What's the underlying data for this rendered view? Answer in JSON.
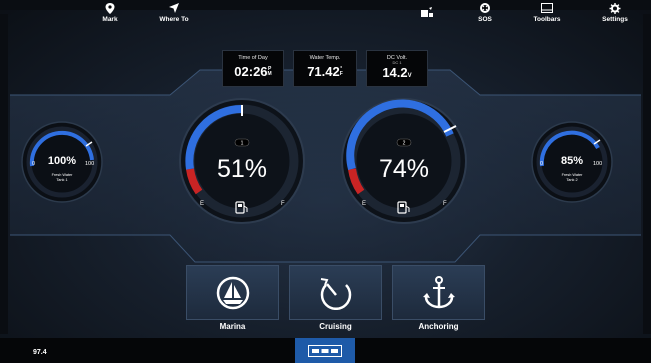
{
  "info": {
    "time": {
      "label": "Time of Day",
      "value": "02:26",
      "unit_top": "P",
      "unit_bottom": "M"
    },
    "water": {
      "label": "Water Temp.",
      "value": "71.42",
      "unit_top": "°",
      "unit_bottom": "F"
    },
    "dc": {
      "label": "DC Volt.",
      "sub": "DC 1",
      "value": "14.2",
      "unit": "V"
    }
  },
  "gauges": {
    "fresh1": {
      "value": "100%",
      "min": "0",
      "max": "100",
      "name_line1": "Fresh Water",
      "name_line2": "Tank 1",
      "level": 1.0
    },
    "fuel1": {
      "value": "51%",
      "index": "1",
      "empty": "E",
      "full": "F",
      "level": 0.51
    },
    "fuel2": {
      "value": "74%",
      "index": "2",
      "empty": "E",
      "full": "F",
      "level": 0.74
    },
    "fresh2": {
      "value": "85%",
      "min": "0",
      "max": "100",
      "name_line1": "Fresh Water",
      "name_line2": "Tank 2",
      "level": 0.85
    }
  },
  "modes": [
    {
      "label": "Marina",
      "icon": "sailboat-icon"
    },
    {
      "label": "Cruising",
      "icon": "gauge-icon"
    },
    {
      "label": "Anchoring",
      "icon": "anchor-icon"
    }
  ],
  "bottom_bar": {
    "speed": "97.4",
    "mark": "Mark",
    "where_to": "Where To",
    "sos": "SOS",
    "toolbars": "Toolbars",
    "settings": "Settings"
  },
  "colors": {
    "accent": "#2f6fe0",
    "warning": "#d12a2a",
    "panel": "#050608"
  }
}
